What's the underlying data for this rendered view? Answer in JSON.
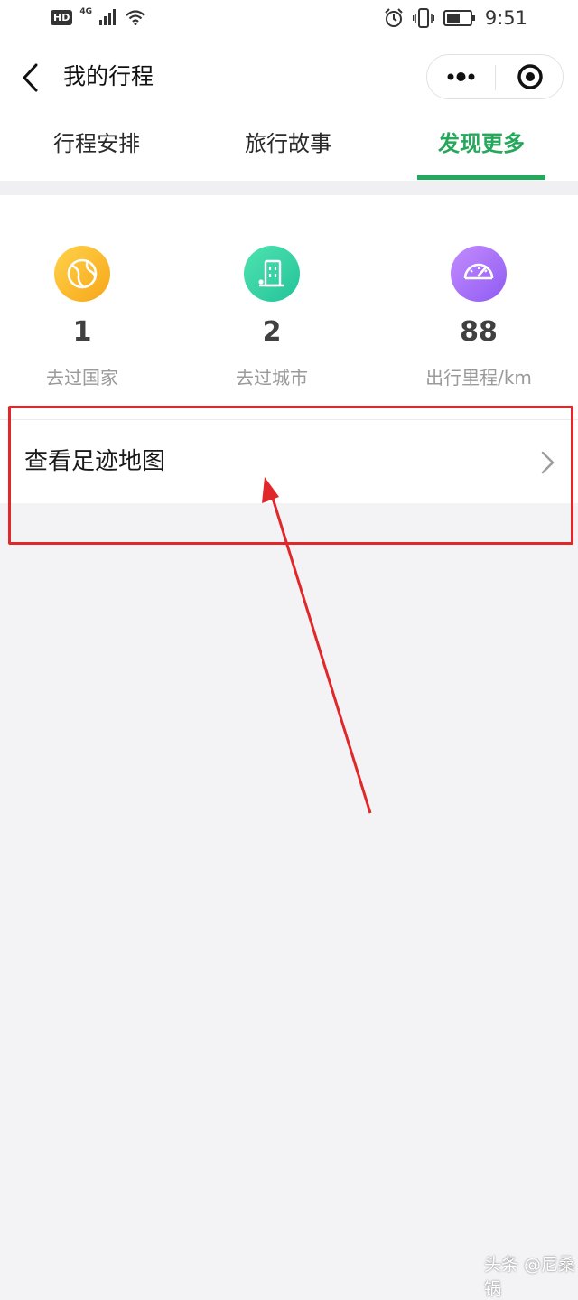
{
  "status_bar": {
    "hd_label": "HD",
    "network_label": "4G",
    "time": "9:51"
  },
  "nav": {
    "title": "我的行程"
  },
  "tabs": [
    {
      "label": "行程安排",
      "active": false
    },
    {
      "label": "旅行故事",
      "active": false
    },
    {
      "label": "发现更多",
      "active": true
    }
  ],
  "stats": [
    {
      "value": "1",
      "label": "去过国家",
      "icon": "globe-icon"
    },
    {
      "value": "2",
      "label": "去过城市",
      "icon": "building-icon"
    },
    {
      "value": "88",
      "label": "出行里程/km",
      "icon": "speedometer-icon"
    }
  ],
  "footprint_row": {
    "label": "查看足迹地图"
  },
  "watermark": "头条 @尼桑锅",
  "colors": {
    "accent_green": "#25a85c",
    "annotation_red": "#e0282a",
    "background": "#f3f3f5"
  }
}
